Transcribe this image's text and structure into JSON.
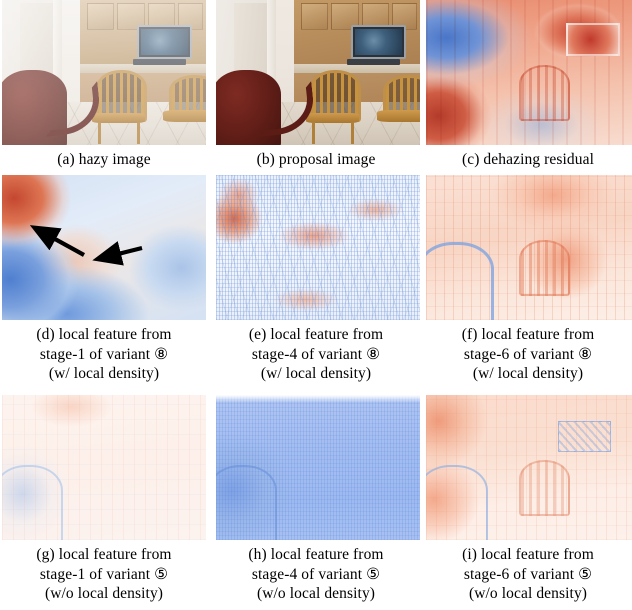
{
  "figure": {
    "type": "qualitative-comparison-grid",
    "rows": 3,
    "columns": 3,
    "panel_count": 9
  },
  "panels": [
    {
      "id": "a",
      "name": "hazy-image",
      "kind": "photo",
      "caption_lines": [
        "(a) hazy image"
      ]
    },
    {
      "id": "b",
      "name": "proposal-image",
      "kind": "photo",
      "caption_lines": [
        "(b) proposal image"
      ]
    },
    {
      "id": "c",
      "name": "dehazing-residual",
      "kind": "heatmap",
      "colormap": "coolwarm",
      "caption_lines": [
        "(c) dehazing residual"
      ]
    },
    {
      "id": "d",
      "name": "local-feature-stage1-variant8",
      "kind": "heatmap",
      "colormap": "coolwarm",
      "stage": "stage-1",
      "variant": "⑧",
      "density": "w/ local density",
      "annotations": [
        "arrow",
        "arrow"
      ],
      "caption_lines": [
        "(d) local feature from",
        "stage-1 of variant ⑧",
        "(w/ local density)"
      ]
    },
    {
      "id": "e",
      "name": "local-feature-stage4-variant8",
      "kind": "heatmap",
      "colormap": "coolwarm",
      "stage": "stage-4",
      "variant": "⑧",
      "density": "w/ local density",
      "caption_lines": [
        "(e) local feature from",
        "stage-4 of variant ⑧",
        "(w/ local density)"
      ]
    },
    {
      "id": "f",
      "name": "local-feature-stage6-variant8",
      "kind": "heatmap",
      "colormap": "coolwarm",
      "stage": "stage-6",
      "variant": "⑧",
      "density": "w/ local density",
      "caption_lines": [
        "(f) local feature from",
        "stage-6 of variant ⑧",
        "(w/ local density)"
      ]
    },
    {
      "id": "g",
      "name": "local-feature-stage1-variant5",
      "kind": "heatmap",
      "colormap": "coolwarm",
      "stage": "stage-1",
      "variant": "⑤",
      "density": "w/o local density",
      "caption_lines": [
        "(g) local feature from",
        "stage-1 of variant ⑤",
        "(w/o local density)"
      ]
    },
    {
      "id": "h",
      "name": "local-feature-stage4-variant5",
      "kind": "heatmap",
      "colormap": "coolwarm",
      "stage": "stage-4",
      "variant": "⑤",
      "density": "w/o local density",
      "caption_lines": [
        "(h) local feature from",
        "stage-4 of variant ⑤",
        "(w/o local density)"
      ]
    },
    {
      "id": "i",
      "name": "local-feature-stage6-variant5",
      "kind": "heatmap",
      "colormap": "coolwarm",
      "stage": "stage-6",
      "variant": "⑤",
      "density": "w/o local density",
      "caption_lines": [
        "(i) local feature from",
        "stage-6 of variant ⑤",
        "(w/o local density)"
      ]
    }
  ],
  "colors": {
    "warm_high": "#b43b2a",
    "warm_mid": "#ef9b7b",
    "warm_low": "#fae1d5",
    "cool_high": "#4a76c8",
    "cool_mid": "#8fb0e0",
    "cool_low": "#dfe9fa",
    "neutral": "#ffffff",
    "annotation_arrow": "#000000",
    "caption_text": "#000000",
    "background": "#ffffff"
  }
}
